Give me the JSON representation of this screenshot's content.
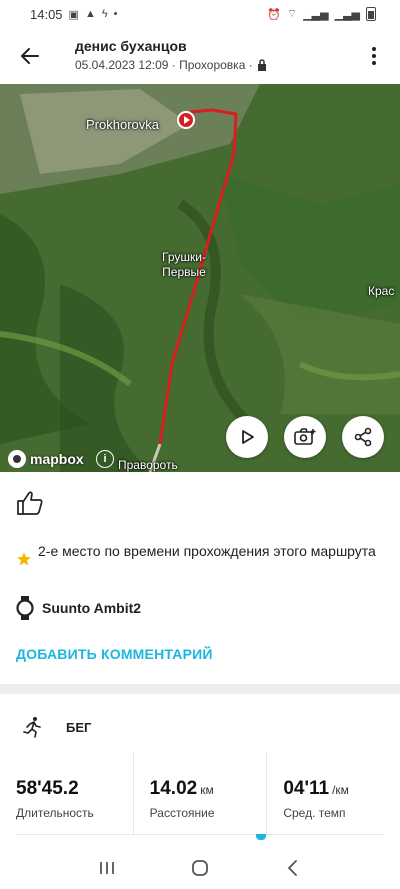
{
  "status_bar": {
    "time": "14:05"
  },
  "header": {
    "title": "денис буханцов",
    "date_location": "05.04.2023 12:09 · Прохоровка ·"
  },
  "map": {
    "places": {
      "prokhorovka": "Prokhorovka",
      "grushki_line1": "Грушки-",
      "grushki_line2": "Первые",
      "kras": "Крас",
      "pravor": "Правороть"
    },
    "attribution": "mapbox",
    "info_symbol": "i",
    "route_color": "#d81e1e"
  },
  "achievement": {
    "text": "2-е место по времени прохождения этого маршрута"
  },
  "device": {
    "name": "Suunto Ambit2"
  },
  "add_comment_label": "ДОБАВИТЬ КОММЕНТАРИЙ",
  "activity": {
    "label": "БЕГ"
  },
  "stats": [
    {
      "value": "58'45.2",
      "unit": "",
      "label": "Длительность"
    },
    {
      "value": "14.02",
      "unit": "км",
      "label": "Расстояние"
    },
    {
      "value": "04'11",
      "unit": "/км",
      "label": "Сред. темп"
    }
  ],
  "colors": {
    "accent": "#1cb6e0",
    "star": "#f5b800"
  },
  "icons": {
    "back": "back-arrow-icon",
    "more": "more-vertical-icon",
    "lock": "lock-icon",
    "play": "play-icon",
    "add_photo": "add-photo-icon",
    "share": "share-icon",
    "like": "thumbs-up-icon",
    "star": "star-icon",
    "watch": "watch-icon",
    "runner": "runner-icon"
  }
}
